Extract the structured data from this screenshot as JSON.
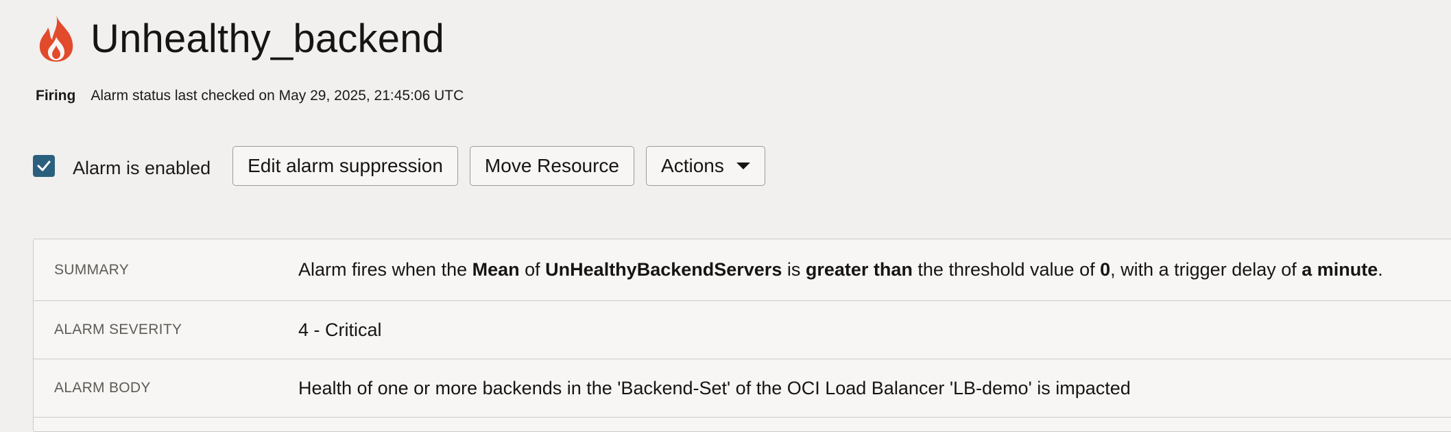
{
  "header": {
    "icon": "fire-icon",
    "title": "Unhealthy_backend",
    "status": "Firing",
    "status_detail": "Alarm status last checked on May 29, 2025, 21:45:06 UTC"
  },
  "toolbar": {
    "enabled_checked": true,
    "enabled_label": "Alarm is enabled",
    "edit_suppression_label": "Edit alarm suppression",
    "move_resource_label": "Move Resource",
    "actions_label": "Actions"
  },
  "details": {
    "summary": {
      "label": "SUMMARY",
      "parts": {
        "t1": "Alarm fires when the ",
        "b1": "Mean",
        "t2": " of ",
        "b2": "UnHealthyBackendServers",
        "t3": " is ",
        "b3": "greater than",
        "t4": " the threshold value of ",
        "b4": "0",
        "t5": ", with a trigger delay of ",
        "b5": "a minute",
        "t6": "."
      }
    },
    "severity": {
      "label": "ALARM SEVERITY",
      "value": "4 - Critical"
    },
    "body": {
      "label": "ALARM BODY",
      "value": "Health of one or more backends in the 'Backend-Set' of the OCI Load Balancer 'LB-demo' is impacted"
    }
  },
  "colors": {
    "fire": "#e24a2c",
    "checkbox": "#2b5f7e",
    "background": "#f1f0ee"
  }
}
